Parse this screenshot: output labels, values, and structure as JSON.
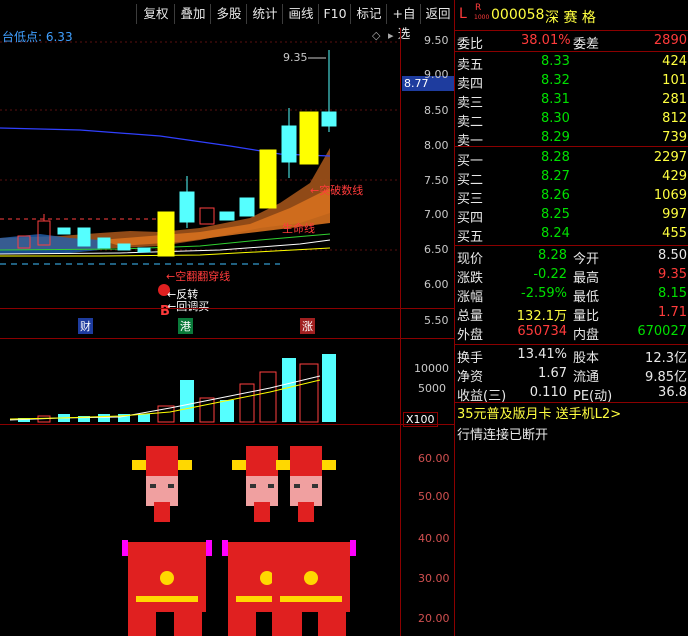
{
  "toolbar": {
    "buttons": [
      "复权",
      "叠加",
      "多股",
      "统计",
      "画线",
      "F10",
      "标记",
      "+自选",
      "返回"
    ]
  },
  "chart": {
    "low_label": "台低点: 6.33",
    "high_marker": "9.35",
    "current_price_tag": "8.77",
    "price_axis": [
      "9.50",
      "9.00",
      "8.50",
      "8.00",
      "7.50",
      "7.00",
      "6.50",
      "6.00",
      "5.50"
    ],
    "annotations": {
      "break_line": "←突破数线",
      "bull_line": "←生命线",
      "bull_label": "生命线",
      "cross_line": "←空翻翻穿线",
      "reversal": "←反转",
      "pullback": "←回调买",
      "b_mark": "B"
    },
    "tags": [
      "财",
      "港",
      "涨"
    ],
    "volume_axis": [
      "10000",
      "5000"
    ],
    "volume_unit": "X100",
    "sub_axis": [
      "60.00",
      "50.00",
      "40.00",
      "30.00",
      "20.00"
    ]
  },
  "stock": {
    "l_mark": "L",
    "r_mark": "R",
    "r_sub": "1000",
    "code": "000058",
    "name": "深 赛 格"
  },
  "orderbook": {
    "ratio_label": "委比",
    "ratio": "38.01%",
    "diff_label": "委差",
    "diff": "2890",
    "asks": [
      {
        "label": "卖五",
        "price": "8.33",
        "vol": "424"
      },
      {
        "label": "卖四",
        "price": "8.32",
        "vol": "101"
      },
      {
        "label": "卖三",
        "price": "8.31",
        "vol": "281"
      },
      {
        "label": "卖二",
        "price": "8.30",
        "vol": "812"
      },
      {
        "label": "卖一",
        "price": "8.29",
        "vol": "739"
      }
    ],
    "bids": [
      {
        "label": "买一",
        "price": "8.28",
        "vol": "2297"
      },
      {
        "label": "买二",
        "price": "8.27",
        "vol": "429"
      },
      {
        "label": "买三",
        "price": "8.26",
        "vol": "1069"
      },
      {
        "label": "买四",
        "price": "8.25",
        "vol": "997"
      },
      {
        "label": "买五",
        "price": "8.24",
        "vol": "455"
      }
    ]
  },
  "quote": [
    {
      "l1": "现价",
      "v1": "8.28",
      "l2": "今开",
      "v2": "8.50",
      "c1": "green",
      "c2": "white"
    },
    {
      "l1": "涨跌",
      "v1": "-0.22",
      "l2": "最高",
      "v2": "9.35",
      "c1": "green",
      "c2": "red"
    },
    {
      "l1": "涨幅",
      "v1": "-2.59%",
      "l2": "最低",
      "v2": "8.15",
      "c1": "green",
      "c2": "green"
    },
    {
      "l1": "总量",
      "v1": "132.1万",
      "l2": "量比",
      "v2": "1.71",
      "c1": "yellow",
      "c2": "red"
    },
    {
      "l1": "外盘",
      "v1": "650734",
      "l2": "内盘",
      "v2": "670027",
      "c1": "red",
      "c2": "green"
    }
  ],
  "fundamentals": [
    {
      "l1": "换手",
      "v1": "13.41%",
      "l2": "股本",
      "v2": "12.3亿"
    },
    {
      "l1": "净资",
      "v1": "1.67",
      "l2": "流通",
      "v2": "9.85亿"
    },
    {
      "l1": "收益(三)",
      "v1": "0.110",
      "l2": "PE(动)",
      "v2": "36.8"
    }
  ],
  "promo": "35元普及版月卡 送手机L2>",
  "status": "行情连接已断开"
}
